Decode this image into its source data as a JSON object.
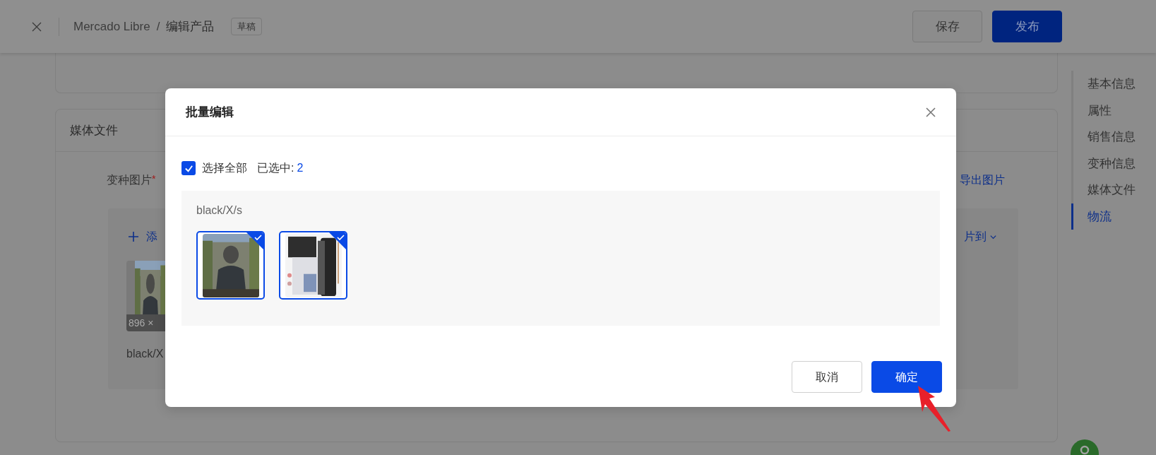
{
  "header": {
    "breadcrumb": [
      {
        "label": "Mercado Libre"
      },
      {
        "label": "编辑产品"
      }
    ],
    "separator": "/",
    "tag": "草稿",
    "buttons": [
      {
        "label": "保存",
        "kind": "secondary"
      },
      {
        "label": "发布",
        "kind": "primary"
      }
    ]
  },
  "nav": {
    "items": [
      {
        "label": "基本信息",
        "selected": false
      },
      {
        "label": "属性",
        "selected": false
      },
      {
        "label": "销售信息",
        "selected": false
      },
      {
        "label": "变种信息",
        "selected": false
      },
      {
        "label": "媒体文件",
        "selected": false
      },
      {
        "label": "物流",
        "selected": true
      }
    ]
  },
  "media_card": {
    "title": "媒体文件",
    "field_label": "变种图片",
    "required_mark": "*",
    "export_link": "导出图片",
    "add_link": "添",
    "move_menu": "片到",
    "thumbnail_size": "896 ×",
    "variant_label": "black/X"
  },
  "dialog": {
    "title": "批量编辑",
    "select_all": {
      "label": "选择全部",
      "checked": true
    },
    "selected_count_label": "已选中:",
    "selected_count": "2",
    "group": {
      "label": "black/X/s",
      "images": [
        {
          "selected": true
        },
        {
          "selected": true
        }
      ]
    },
    "buttons": [
      {
        "label": "取消",
        "kind": "secondary"
      },
      {
        "label": "确定",
        "kind": "primary"
      }
    ]
  }
}
